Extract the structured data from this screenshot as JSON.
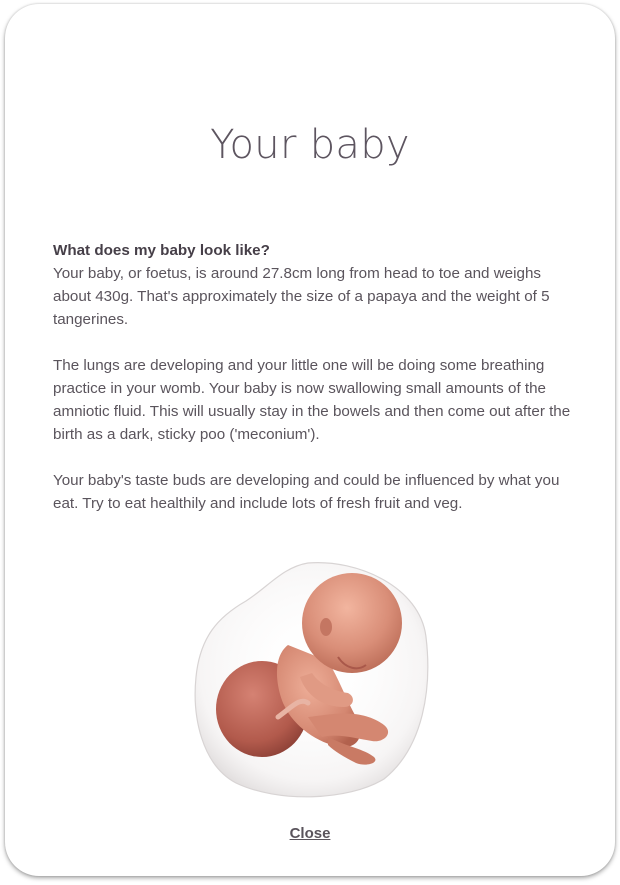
{
  "modal": {
    "title": "Your baby",
    "section_heading": "What does my baby look like?",
    "paragraphs": [
      "Your baby, or foetus, is around 27.8cm long from head to toe and weighs about 430g. That's approximately the size of a papaya and the weight of 5 tangerines.",
      "The lungs are developing and your little one will be doing some breathing practice in your womb. Your baby is now swallowing small amounts of the amniotic fluid. This will usually stay in the bowels and then come out after the birth as a dark, sticky poo ('meconium').",
      "Your baby's taste buds are developing and could be influenced by what you eat. Try to eat healthily and include lots of fresh fruit and veg."
    ],
    "illustration_icon": "foetus-illustration",
    "close_label": "Close"
  },
  "colors": {
    "text": "#5a545c",
    "title": "#5d5560",
    "skin": "#d98e78",
    "skin_dark": "#b5604c"
  }
}
